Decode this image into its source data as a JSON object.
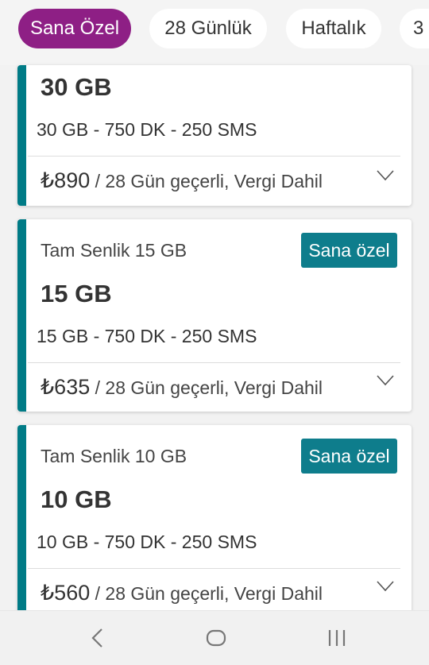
{
  "tabs": [
    {
      "label": "Sana Özel",
      "active": true
    },
    {
      "label": "28 Günlük",
      "active": false
    },
    {
      "label": "Haftalık",
      "active": false
    },
    {
      "label": "3",
      "active": false
    }
  ],
  "cards": [
    {
      "name": "",
      "badge": "",
      "gb": "30 GB",
      "details": "30 GB - 750 DK - 250 SMS",
      "price": "₺890",
      "price_suffix": " / 28 Gün geçerli, Vergi Dahil"
    },
    {
      "name": "Tam Senlik 15 GB",
      "badge": "Sana özel",
      "gb": "15 GB",
      "details": "15 GB - 750 DK - 250 SMS",
      "price": "₺635",
      "price_suffix": " / 28 Gün geçerli, Vergi Dahil"
    },
    {
      "name": "Tam Senlik 10 GB",
      "badge": "Sana özel",
      "gb": "10 GB",
      "details": "10 GB - 750 DK - 250 SMS",
      "price": "₺560",
      "price_suffix": " / 28 Gün geçerli, Vergi Dahil"
    }
  ],
  "colors": {
    "accent_purple": "#8e1f85",
    "accent_teal": "#007b86",
    "badge_teal": "#0e7d8c"
  },
  "icons": {
    "chevron": "chevron-down-icon",
    "nav_back": "back-icon",
    "nav_home": "home-icon",
    "nav_recents": "recents-icon"
  }
}
